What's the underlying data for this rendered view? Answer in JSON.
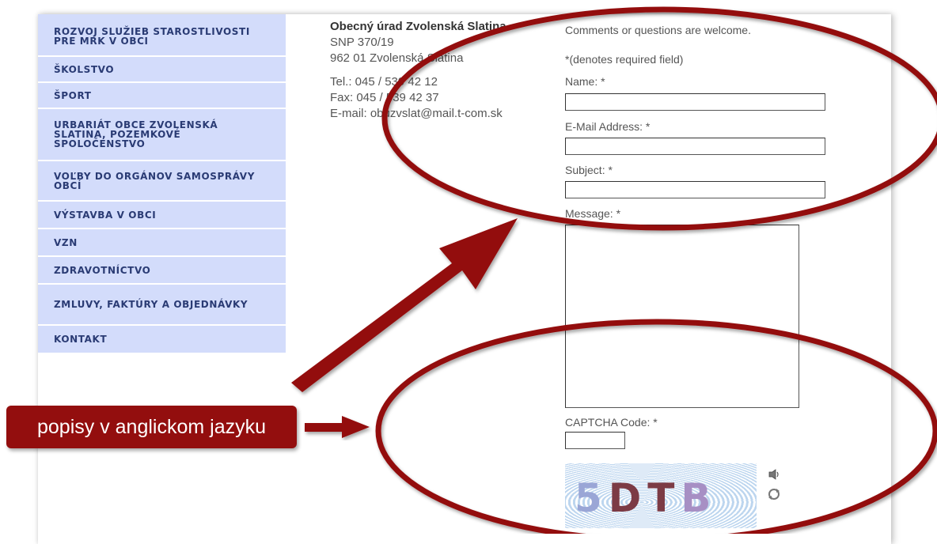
{
  "sidebar": {
    "items": [
      {
        "label": "ROZVOJ SLUŽIEB STAROSTLIVOSTI PRE MRK V OBCI"
      },
      {
        "label": "ŠKOLSTVO"
      },
      {
        "label": "ŠPORT"
      },
      {
        "label": "URBARIÁT OBCE ZVOLENSKÁ SLATINA, POZEMKOVÉ SPOLOČENSTVO"
      },
      {
        "label": "VOĽBY DO ORGÁNOV SAMOSPRÁVY OBCÍ"
      },
      {
        "label": "VÝSTAVBA V OBCI"
      },
      {
        "label": "VZN"
      },
      {
        "label": "ZDRAVOTNÍCTVO"
      },
      {
        "label": "ZMLUVY, FAKTÚRY A OBJEDNÁVKY"
      },
      {
        "label": "KONTAKT"
      }
    ]
  },
  "address": {
    "org": "Obecný úrad Zvolenská Slatina",
    "street": "SNP 370/19",
    "city": "962 01 Zvolenská Slatina",
    "tel": "Tel.: 045 / 539 42 12",
    "fax": "Fax: 045 / 539 42 37",
    "email": "E-mail: obuzvslat@mail.t-com.sk"
  },
  "form": {
    "intro": "Comments or questions are welcome.",
    "required_note": "*(denotes required field)",
    "name_label": "Name: *",
    "email_label": "E-Mail Address: *",
    "subject_label": "Subject: *",
    "message_label": "Message: *",
    "captcha_label": "CAPTCHA Code: *",
    "name_value": "",
    "email_value": "",
    "subject_value": "",
    "message_value": "",
    "captcha_value": ""
  },
  "captcha": {
    "c1": "5",
    "c2": "DT",
    "c3": "B"
  },
  "icons": {
    "audio": "speaker-icon",
    "refresh": "refresh-icon"
  },
  "annotation": {
    "callout_text": "popisy v anglickom jazyku",
    "color": "#930e0e"
  },
  "colors": {
    "menu_bg": "#d3dcfb",
    "menu_text": "#2a3b74"
  }
}
